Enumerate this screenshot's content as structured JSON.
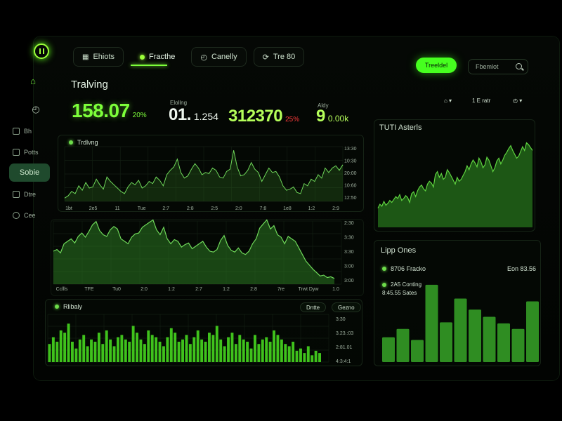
{
  "colors": {
    "accent": "#46ff1f",
    "bright": "#9cff3a",
    "red": "#ff3b3b",
    "bg": "#000000"
  },
  "topbar": {
    "tabs": [
      {
        "label": "Ehiots"
      },
      {
        "label": "Fracthe"
      },
      {
        "label": "Canelly"
      },
      {
        "label": "Tre 80"
      }
    ],
    "cta": "Treeldel",
    "search": "Fbemlot"
  },
  "sidebar": {
    "items": [
      {
        "label": "Bh"
      },
      {
        "label": "Potts"
      },
      {
        "label": "Sobie"
      },
      {
        "label": "Dtre"
      },
      {
        "label": "Cee"
      }
    ]
  },
  "page": {
    "title": "Tralving"
  },
  "kpis": [
    {
      "caption": "",
      "value": "158.07",
      "suffix": "20%",
      "color": "#7dff3a"
    },
    {
      "caption": "Elollng",
      "value": "01.",
      "value2": "1.254",
      "color": "#eef6ee"
    },
    {
      "caption": "",
      "value": "312370",
      "suffix": "25%",
      "color": "#b5ff5a"
    },
    {
      "caption": "Aldy",
      "value": "9",
      "suffix": "0.00k",
      "color": "#b5ff5a"
    }
  ],
  "charts": {
    "trending": {
      "title": "Trdlvng",
      "xticks": [
        "1bt",
        "2e5",
        "11",
        "Tue",
        "2:7",
        "2:8",
        "2:5",
        "2:0",
        "7:8",
        "1e8",
        "1:2",
        "2:9"
      ],
      "yticks": [
        "13:30",
        "10:30",
        "20:00",
        "10:60",
        "12:50"
      ]
    },
    "area": {
      "xticks": [
        "Ccllls",
        "TFE",
        "Tu0",
        "2:0",
        "1:2",
        "2:7",
        "1:2",
        "2:8",
        "7re",
        "Trwt Dyw",
        "1.0"
      ],
      "yticks": [
        "2:30",
        "3:30",
        "3:30",
        "3:00",
        "3:00"
      ]
    },
    "bars": {
      "title": "Rlibaly",
      "chip1": "Dntte",
      "chip2": "Gezno",
      "yticks": [
        "3:30",
        "3.23.:03",
        "2:81.01",
        "4:3:4:1"
      ]
    },
    "assets": {
      "title": "TUTI Asterls"
    },
    "lipp": {
      "title": "Lipp Ones",
      "legend1": "8706 Fracko",
      "legend1_value": "Eon 83.56",
      "legend2": "2A5 Conting",
      "legend3": "8:45.55 Sates"
    }
  },
  "right_head": {
    "a": "",
    "b": "1 E ratr",
    "c": ""
  },
  "chart_data": [
    {
      "type": "line",
      "title": "Trdlvng",
      "series": [
        {
          "values": [
            3,
            5,
            9,
            7,
            14,
            10,
            17,
            12,
            13,
            20,
            15,
            11,
            22,
            18,
            15,
            12,
            9,
            7,
            13,
            17,
            15,
            19,
            12,
            14,
            18,
            16,
            22,
            19,
            14,
            24,
            28,
            31,
            38,
            26,
            21,
            23,
            29,
            34,
            30,
            24,
            26,
            25,
            30,
            28,
            22,
            21,
            27,
            29,
            46,
            31,
            23,
            24,
            28,
            35,
            29,
            26,
            18,
            24,
            30,
            26,
            27,
            22,
            14,
            10,
            11,
            13,
            8,
            7,
            16,
            14,
            20,
            18,
            24,
            21,
            30,
            26,
            30,
            32,
            28,
            33
          ]
        }
      ]
    },
    {
      "type": "area",
      "series": [
        {
          "values": [
            40,
            42,
            38,
            49,
            52,
            55,
            50,
            58,
            62,
            57,
            64,
            72,
            76,
            65,
            60,
            58,
            66,
            70,
            67,
            55,
            52,
            49,
            57,
            61,
            62,
            69,
            72,
            75,
            78,
            66,
            60,
            69,
            55,
            49,
            54,
            52,
            45,
            48,
            50,
            43,
            46,
            49,
            52,
            45,
            40,
            39,
            42,
            53,
            59,
            47,
            41,
            39,
            44,
            38,
            36,
            40,
            49,
            55,
            68,
            73,
            78,
            67,
            71,
            60,
            57,
            49,
            58,
            55,
            52,
            44,
            36,
            28,
            23,
            18,
            14,
            10,
            11,
            8,
            9,
            7
          ]
        }
      ]
    },
    {
      "type": "bar",
      "values": [
        8,
        11,
        9,
        14,
        13,
        17,
        9,
        6,
        10,
        12,
        7,
        10,
        9,
        13,
        8,
        14,
        10,
        7,
        11,
        12,
        10,
        9,
        16,
        13,
        10,
        8,
        14,
        12,
        11,
        9,
        7,
        11,
        15,
        13,
        9,
        10,
        12,
        8,
        11,
        14,
        10,
        9,
        13,
        12,
        16,
        10,
        7,
        11,
        13,
        8,
        12,
        10,
        9,
        6,
        12,
        8,
        10,
        11,
        9,
        14,
        12,
        10,
        8,
        7,
        9,
        5,
        6,
        4,
        7,
        3,
        5,
        4
      ]
    },
    {
      "type": "area",
      "title": "TUTI Asterls",
      "series": [
        {
          "values": [
            20,
            24,
            22,
            27,
            23,
            25,
            28,
            26,
            29,
            32,
            30,
            34,
            28,
            30,
            33,
            31,
            26,
            35,
            37,
            32,
            38,
            42,
            44,
            40,
            38,
            45,
            48,
            46,
            42,
            55,
            58,
            52,
            56,
            50,
            52,
            60,
            57,
            53,
            49,
            45,
            52,
            48,
            50,
            54,
            58,
            64,
            60,
            66,
            70,
            67,
            63,
            72,
            68,
            62,
            65,
            73,
            70,
            64,
            58,
            62,
            69,
            72,
            66,
            70,
            75,
            78,
            82,
            85,
            80,
            76,
            72,
            74,
            79,
            84,
            80,
            88,
            86,
            83,
            80
          ]
        }
      ]
    },
    {
      "type": "bar",
      "title": "Lipp Ones",
      "values": [
        45,
        60,
        40,
        140,
        72,
        115,
        95,
        82,
        70,
        60,
        110
      ]
    }
  ]
}
